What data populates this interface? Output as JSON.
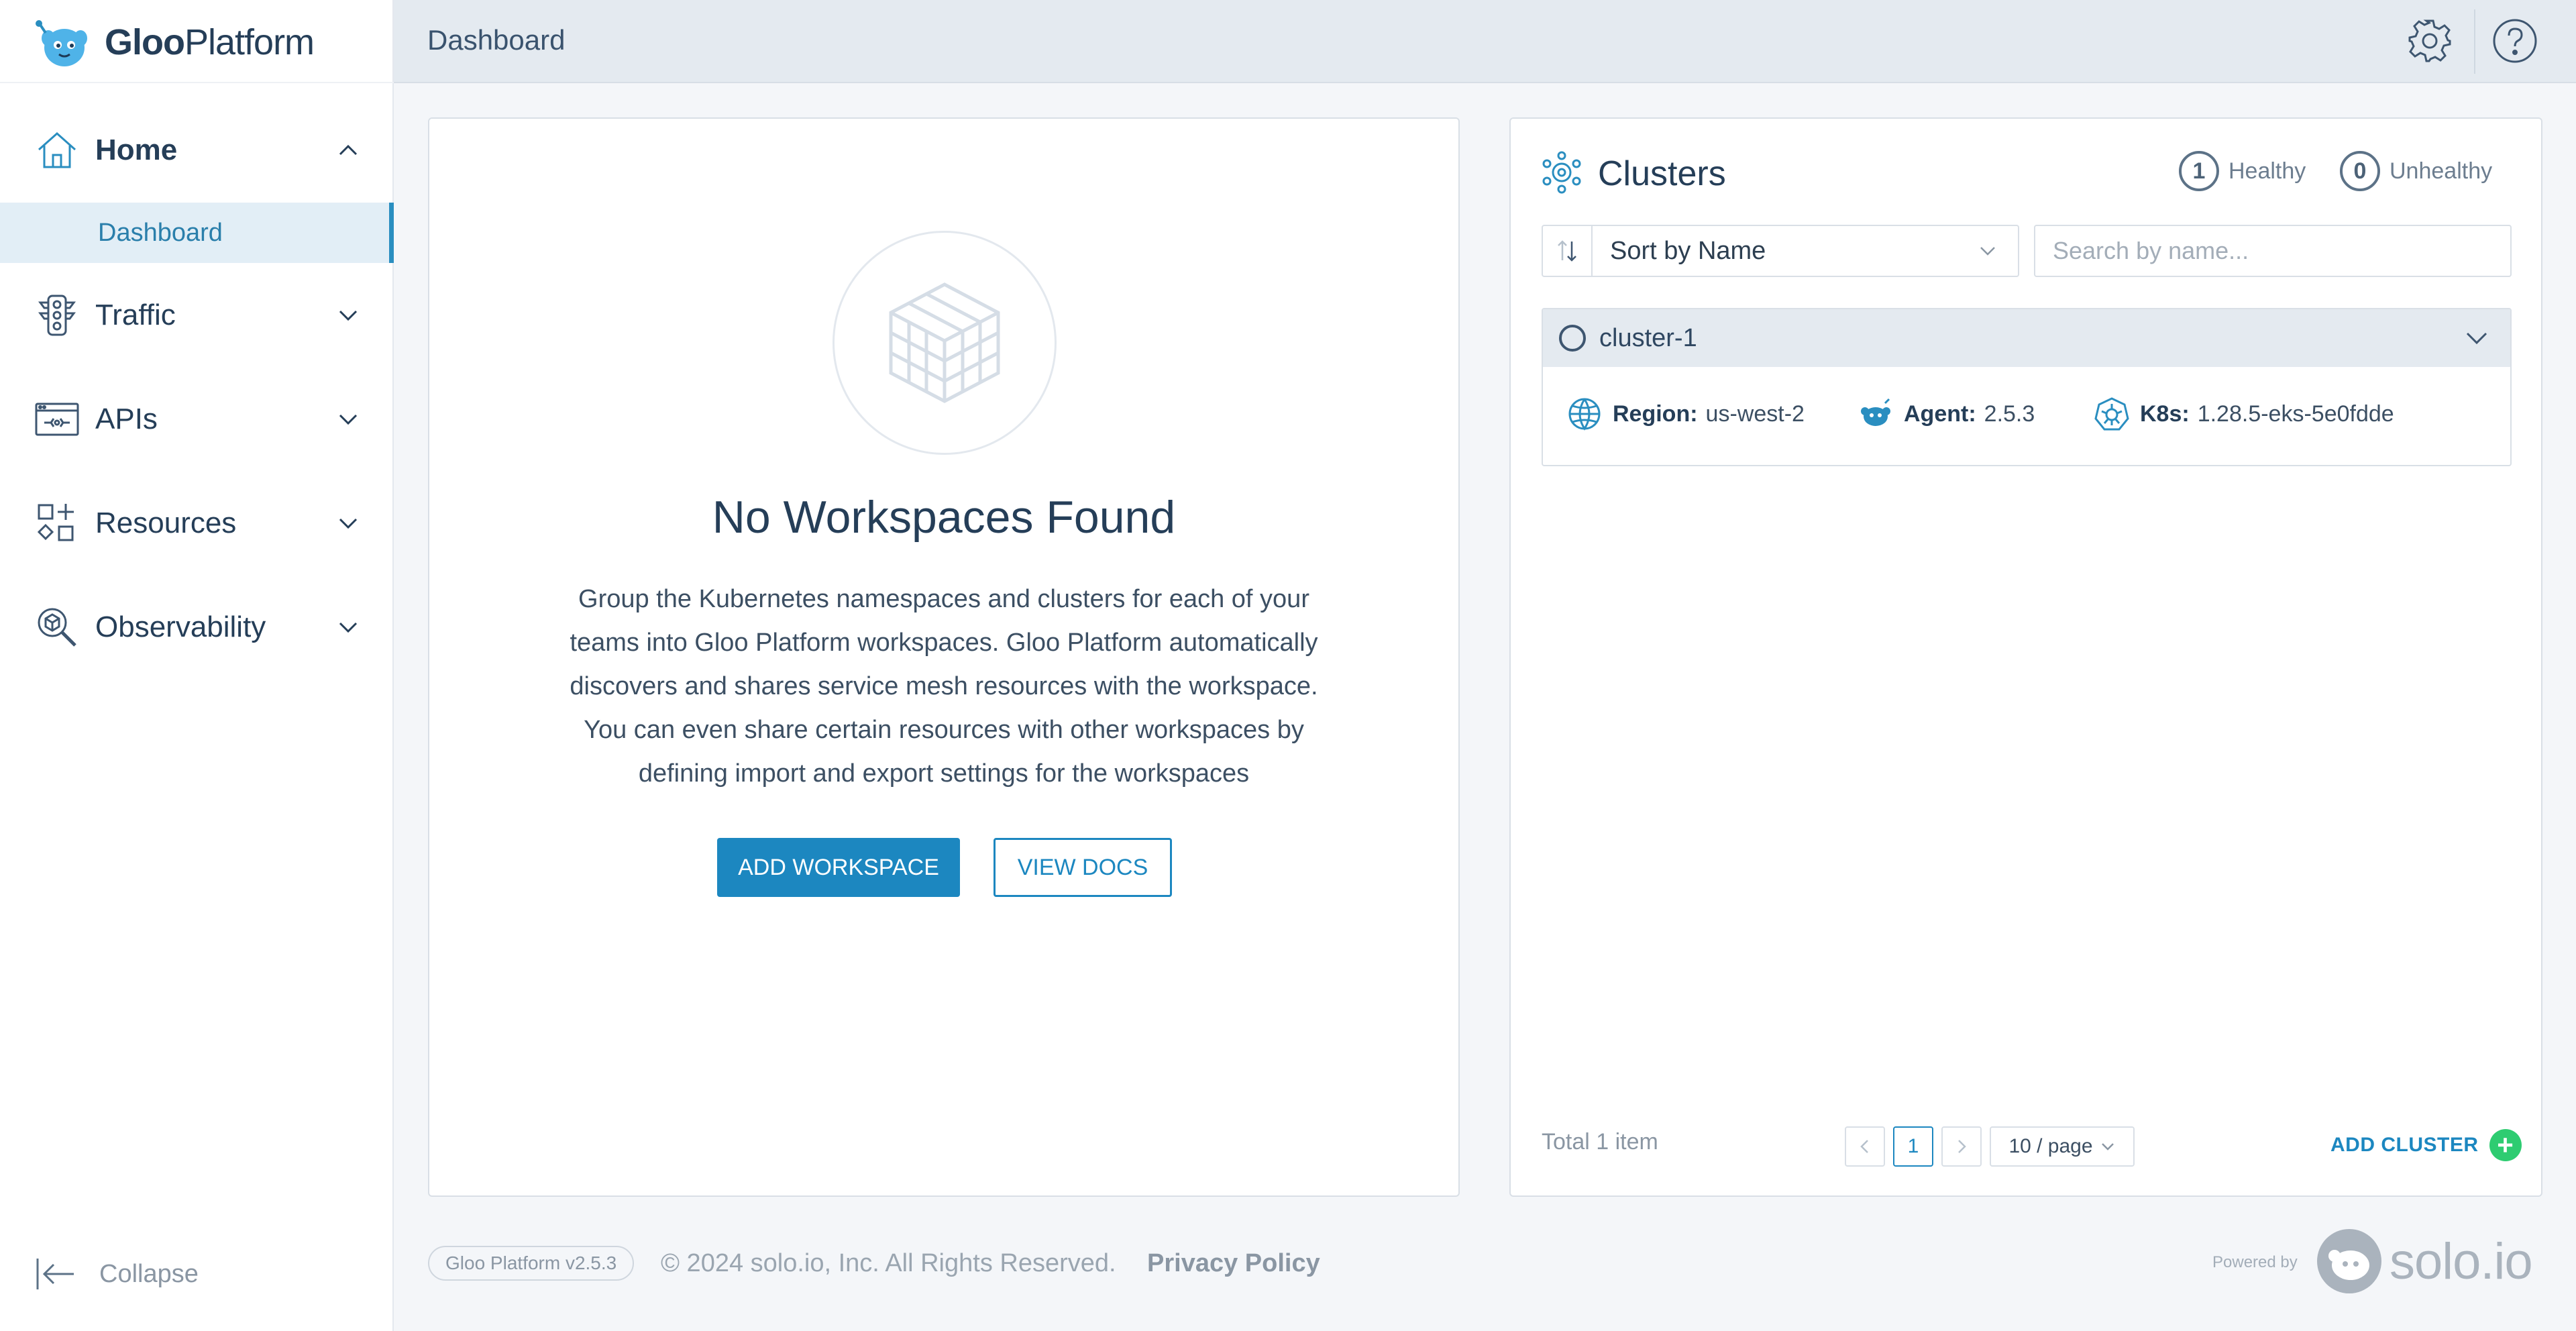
{
  "app": {
    "logo_text_bold": "Gloo",
    "logo_text_rest": "Platform"
  },
  "sidebar": {
    "items": [
      {
        "label": "Home",
        "icon": "home-icon",
        "expanded": true
      },
      {
        "label": "Traffic",
        "icon": "traffic-light-icon",
        "expanded": false
      },
      {
        "label": "APIs",
        "icon": "api-icon",
        "expanded": false
      },
      {
        "label": "Resources",
        "icon": "resources-icon",
        "expanded": false
      },
      {
        "label": "Observability",
        "icon": "observability-icon",
        "expanded": false
      }
    ],
    "sub_item": "Dashboard",
    "collapse_label": "Collapse"
  },
  "header": {
    "title": "Dashboard"
  },
  "workspaces": {
    "empty_title": "No Workspaces Found",
    "empty_body": "Group the Kubernetes namespaces and clusters for each of your teams into Gloo Platform workspaces. Gloo Platform automatically discovers and shares service mesh resources with the workspace. You can even share certain resources with other workspaces by defining import and export settings for the workspaces",
    "add_button": "ADD WORKSPACE",
    "docs_button": "VIEW DOCS"
  },
  "clusters": {
    "title": "Clusters",
    "healthy_count": "1",
    "healthy_label": "Healthy",
    "unhealthy_count": "0",
    "unhealthy_label": "Unhealthy",
    "sort_label": "Sort by Name",
    "search_placeholder": "Search by name...",
    "items": [
      {
        "name": "cluster-1",
        "region_key": "Region:",
        "region": "us-west-2",
        "agent_key": "Agent:",
        "agent": "2.5.3",
        "k8s_key": "K8s:",
        "k8s": "1.28.5-eks-5e0fdde"
      }
    ],
    "total": "Total 1 item",
    "current_page": "1",
    "page_size": "10 / page",
    "add_cluster": "ADD CLUSTER"
  },
  "footer": {
    "version_badge": "Gloo Platform v2.5.3",
    "copyright": "© 2024 solo.io, Inc. All Rights Reserved.",
    "privacy": "Privacy Policy",
    "powered_by": "Powered by",
    "brand": "solo.io"
  },
  "colors": {
    "accent": "#1c87c0",
    "sidebar_active_bg": "#e2eef6",
    "header_bg": "#e4eaf0",
    "success": "#2ecc71"
  }
}
